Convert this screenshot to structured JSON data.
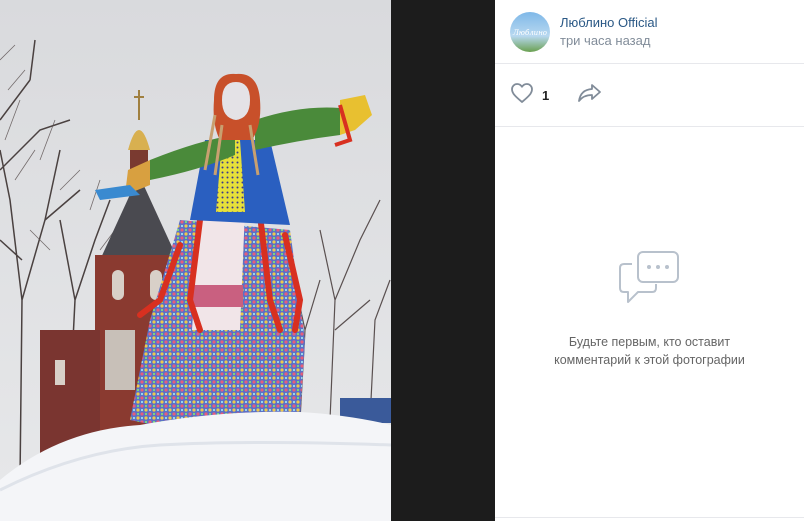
{
  "author": {
    "name": "Люблино Official",
    "time": "три часа назад",
    "avatar_text": "Люблино"
  },
  "actions": {
    "like_count": "1"
  },
  "comments": {
    "empty_text": "Будьте первым, кто оставит комментарий к этой фотографии"
  },
  "colors": {
    "link": "#2a5885",
    "muted": "#818c99",
    "divider": "#e7e8ec"
  },
  "icons": [
    "heart-icon",
    "share-icon",
    "comments-empty-icon"
  ]
}
